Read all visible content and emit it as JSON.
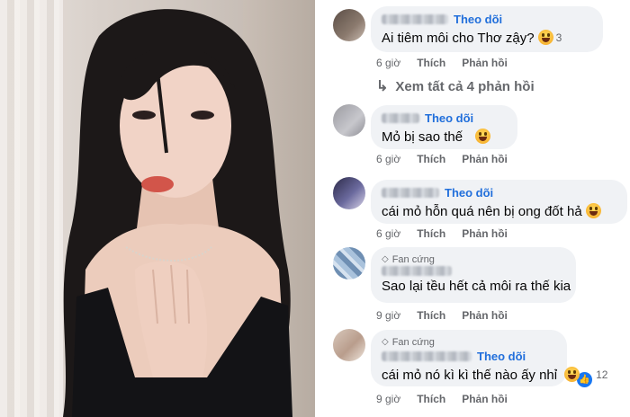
{
  "comments": [
    {
      "follow_label": "Theo dõi",
      "text": "Ai tiêm môi cho Thơ zậy?",
      "reaction_count": "3",
      "time": "6 giờ",
      "like": "Thích",
      "reply": "Phản hồi",
      "view_replies": "Xem tất cả 4 phản hồi"
    },
    {
      "follow_label": "Theo dõi",
      "text": "Mỏ bị sao thế",
      "time": "6 giờ",
      "like": "Thích",
      "reply": "Phản hồi"
    },
    {
      "follow_label": "Theo dõi",
      "text": "cái mỏ hỗn quá nên bị ong đốt hả",
      "time": "6 giờ",
      "like": "Thích",
      "reply": "Phản hồi"
    },
    {
      "badge": "Fan cứng",
      "text": "Sao lại tều hết cả môi ra thế kia",
      "time": "9 giờ",
      "like": "Thích",
      "reply": "Phản hồi"
    },
    {
      "badge": "Fan cứng",
      "follow_label": "Theo dõi",
      "text": "cái mỏ nó kì kì thế nào ấy nhỉ",
      "reaction_count": "12",
      "time": "9 giờ",
      "like": "Thích",
      "reply": "Phản hồi"
    }
  ],
  "icons": {
    "reaction": "haha-emoji-icon",
    "like": "like-icon",
    "badge": "diamond-icon",
    "reply_arrow": "reply-arrow-icon"
  },
  "colors": {
    "follow": "#216fdb",
    "bubble": "#f0f2f5",
    "meta": "#65676b"
  }
}
